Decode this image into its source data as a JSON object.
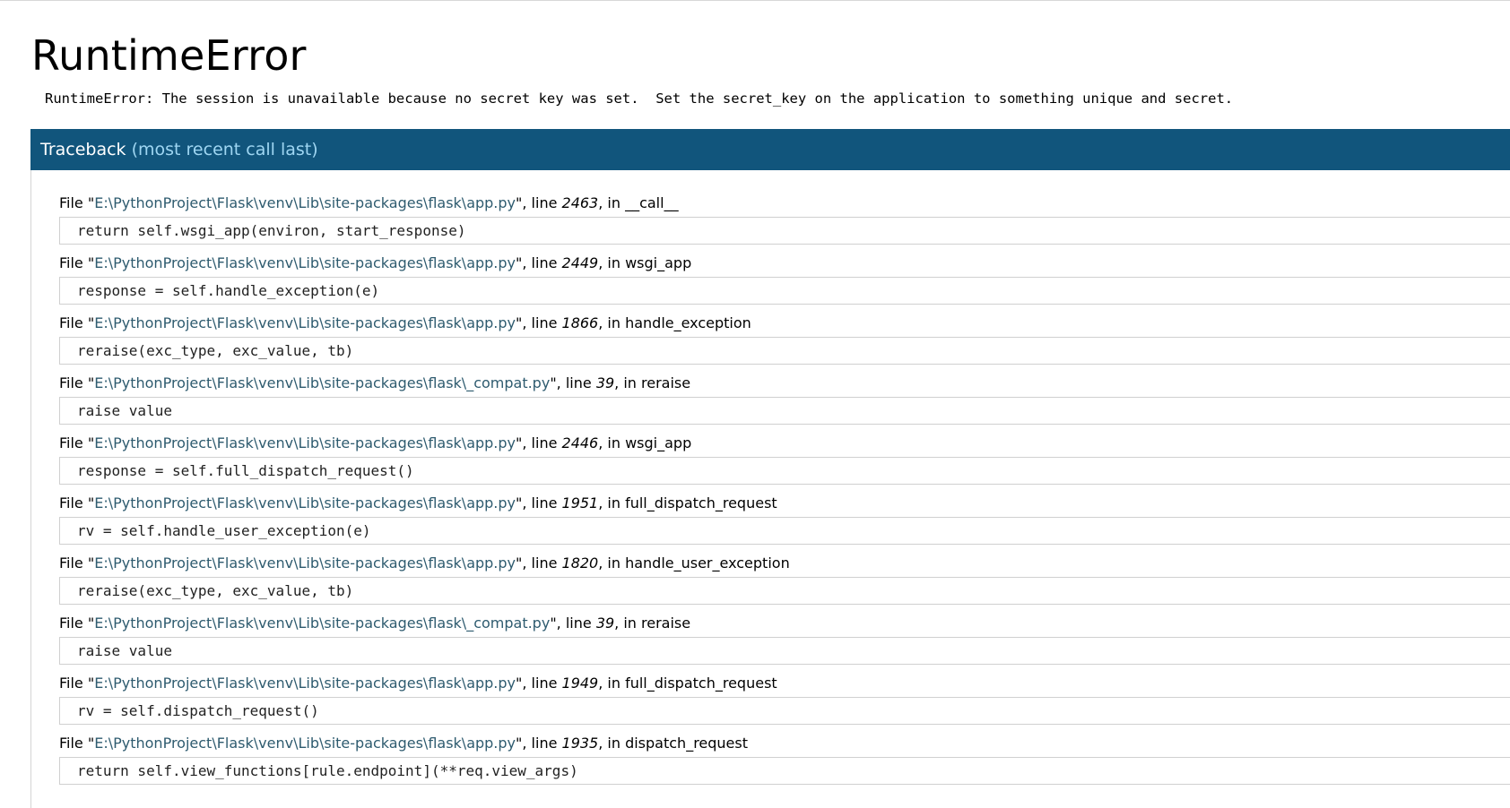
{
  "error": {
    "title": "RuntimeError",
    "message": "RuntimeError: The session is unavailable because no secret key was set.  Set the secret_key on the application to something unique and secret."
  },
  "traceback": {
    "header_label": "Traceback",
    "header_sub": "(most recent call last)",
    "frames": [
      {
        "file_prefix": "File \"",
        "filename": "E:\\PythonProject\\Flask\\venv\\Lib\\site-packages\\flask\\app.py",
        "line_prefix": "\", line ",
        "lineno": "2463",
        "func_prefix": ", in ",
        "function": "__call__",
        "code": "return self.wsgi_app(environ, start_response)"
      },
      {
        "file_prefix": "File \"",
        "filename": "E:\\PythonProject\\Flask\\venv\\Lib\\site-packages\\flask\\app.py",
        "line_prefix": "\", line ",
        "lineno": "2449",
        "func_prefix": ", in ",
        "function": "wsgi_app",
        "code": "response = self.handle_exception(e)"
      },
      {
        "file_prefix": "File \"",
        "filename": "E:\\PythonProject\\Flask\\venv\\Lib\\site-packages\\flask\\app.py",
        "line_prefix": "\", line ",
        "lineno": "1866",
        "func_prefix": ", in ",
        "function": "handle_exception",
        "code": "reraise(exc_type, exc_value, tb)"
      },
      {
        "file_prefix": "File \"",
        "filename": "E:\\PythonProject\\Flask\\venv\\Lib\\site-packages\\flask\\_compat.py",
        "line_prefix": "\", line ",
        "lineno": "39",
        "func_prefix": ", in ",
        "function": "reraise",
        "code": "raise value"
      },
      {
        "file_prefix": "File \"",
        "filename": "E:\\PythonProject\\Flask\\venv\\Lib\\site-packages\\flask\\app.py",
        "line_prefix": "\", line ",
        "lineno": "2446",
        "func_prefix": ", in ",
        "function": "wsgi_app",
        "code": "response = self.full_dispatch_request()"
      },
      {
        "file_prefix": "File \"",
        "filename": "E:\\PythonProject\\Flask\\venv\\Lib\\site-packages\\flask\\app.py",
        "line_prefix": "\", line ",
        "lineno": "1951",
        "func_prefix": ", in ",
        "function": "full_dispatch_request",
        "code": "rv = self.handle_user_exception(e)"
      },
      {
        "file_prefix": "File \"",
        "filename": "E:\\PythonProject\\Flask\\venv\\Lib\\site-packages\\flask\\app.py",
        "line_prefix": "\", line ",
        "lineno": "1820",
        "func_prefix": ", in ",
        "function": "handle_user_exception",
        "code": "reraise(exc_type, exc_value, tb)"
      },
      {
        "file_prefix": "File \"",
        "filename": "E:\\PythonProject\\Flask\\venv\\Lib\\site-packages\\flask\\_compat.py",
        "line_prefix": "\", line ",
        "lineno": "39",
        "func_prefix": ", in ",
        "function": "reraise",
        "code": "raise value"
      },
      {
        "file_prefix": "File \"",
        "filename": "E:\\PythonProject\\Flask\\venv\\Lib\\site-packages\\flask\\app.py",
        "line_prefix": "\", line ",
        "lineno": "1949",
        "func_prefix": ", in ",
        "function": "full_dispatch_request",
        "code": "rv = self.dispatch_request()"
      },
      {
        "file_prefix": "File \"",
        "filename": "E:\\PythonProject\\Flask\\venv\\Lib\\site-packages\\flask\\app.py",
        "line_prefix": "\", line ",
        "lineno": "1935",
        "func_prefix": ", in ",
        "function": "dispatch_request",
        "code": "return self.view_functions[rule.endpoint](**req.view_args)"
      }
    ]
  },
  "colors": {
    "header_bg": "#11557c",
    "header_sub_text": "#9fd6f2",
    "filename_text": "#2e5b6f"
  }
}
